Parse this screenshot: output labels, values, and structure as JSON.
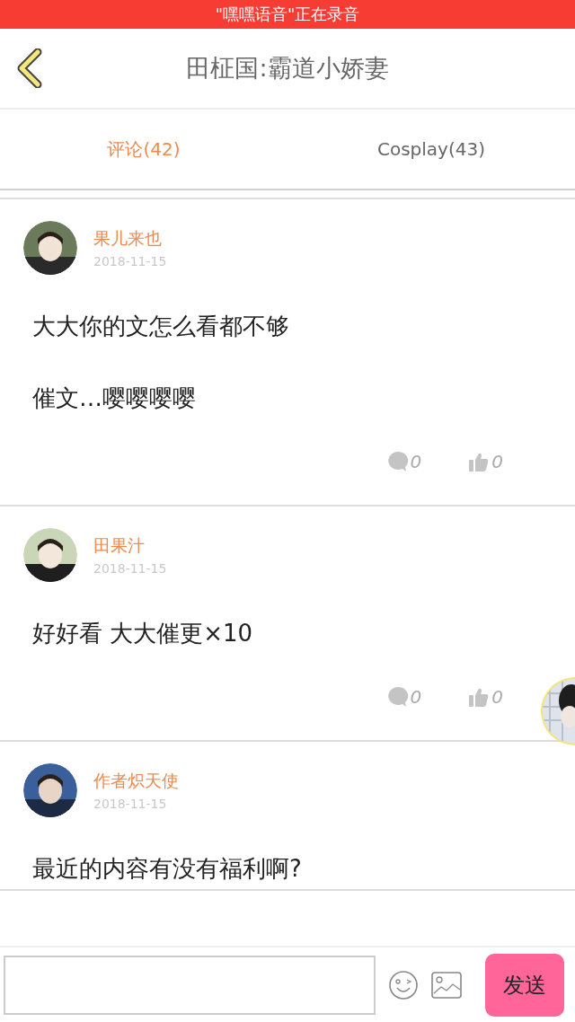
{
  "recording_banner": "\"嘿嘿语音\"正在录音",
  "header": {
    "title": "田柾国:霸道小娇妻"
  },
  "tabs": [
    {
      "label": "评论(42)",
      "selected": true
    },
    {
      "label": "Cosplay(43)",
      "selected": false
    }
  ],
  "comments": [
    {
      "author": "果儿来也",
      "date": "2018-11-15",
      "paragraphs": [
        "大大你的文怎么看都不够",
        "催文…嘤嘤嘤嘤"
      ],
      "reply_count": "0",
      "like_count": "0"
    },
    {
      "author": "田果汁",
      "date": "2018-11-15",
      "paragraphs": [
        "好好看 大大催更×10"
      ],
      "reply_count": "0",
      "like_count": "0"
    },
    {
      "author": "作者炽天使",
      "date": "2018-11-15",
      "paragraphs": [
        "最近的内容有没有福利啊?"
      ]
    }
  ],
  "composer": {
    "send_label": "发送"
  }
}
